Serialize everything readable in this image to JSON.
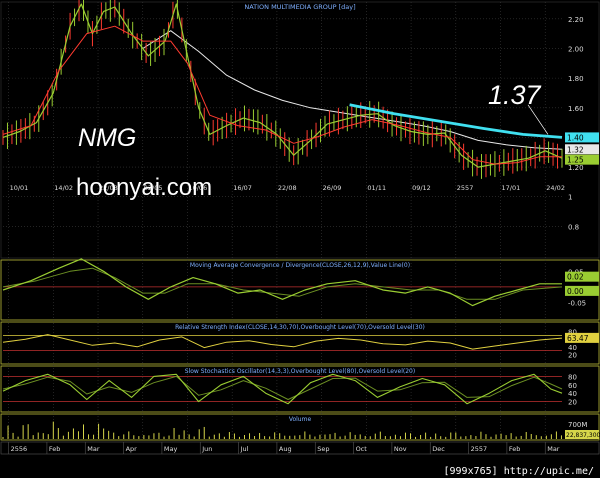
{
  "credit": "[999x765] http://upic.me/",
  "annotations": {
    "ticker": "NMG",
    "site": "hoonyai.com",
    "target": "1.37"
  },
  "colors": {
    "background": "#000000",
    "grid": "#3a3a3a",
    "axis_text": "#dddddd",
    "title_text": "#7fb0ff",
    "price_line": "#9acd32",
    "ma_short": "#ff3b30",
    "ma_long": "#e8e8e8",
    "trendline": "#40e0f0",
    "ref_line": "#e0d040",
    "oversold_line": "#c03030",
    "volume": "#d6d64a"
  },
  "chart_data": [
    {
      "type": "candlestick",
      "title": "NATION MULTIMEDIA GROUP [day]",
      "ylim": [
        0.6,
        2.3
      ],
      "yticks": [
        2.2,
        2.0,
        1.8,
        1.6,
        1.4,
        1.2,
        1.0,
        0.8
      ],
      "ytick_labels": [
        "2.20",
        "2.00",
        "1.80",
        "1.60",
        "1.40",
        "1.20",
        "1",
        "0.8"
      ],
      "last_value_labels": [
        {
          "value": 1.4,
          "label": "1.40",
          "color": "#40e0f0"
        },
        {
          "value": 1.32,
          "label": "1.32",
          "color": "#e8e8e8"
        },
        {
          "value": 1.25,
          "label": "1.25",
          "color": "#9acd32"
        }
      ],
      "date_labels": [
        "10/01",
        "14/02",
        "22/03",
        "02/05",
        "10/06",
        "16/07",
        "22/08",
        "26/09",
        "01/11",
        "09/12",
        "2557",
        "17/01",
        "24/02"
      ],
      "month_labels": [
        "2556",
        "Feb",
        "Mar",
        "Apr",
        "May",
        "Jun",
        "Jul",
        "Aug",
        "Sep",
        "Oct",
        "Nov",
        "Dec",
        "2557",
        "Feb",
        "Mar"
      ],
      "price_path": [
        [
          0,
          1.4
        ],
        [
          3,
          1.44
        ],
        [
          6,
          1.5
        ],
        [
          9,
          1.7
        ],
        [
          12,
          2.15
        ],
        [
          14,
          2.3
        ],
        [
          16,
          2.1
        ],
        [
          18,
          2.25
        ],
        [
          20,
          2.28
        ],
        [
          23,
          2.1
        ],
        [
          26,
          1.95
        ],
        [
          29,
          2.05
        ],
        [
          31,
          2.3
        ],
        [
          33,
          1.95
        ],
        [
          35,
          1.6
        ],
        [
          37,
          1.42
        ],
        [
          40,
          1.48
        ],
        [
          43,
          1.53
        ],
        [
          46,
          1.5
        ],
        [
          49,
          1.42
        ],
        [
          52,
          1.28
        ],
        [
          55,
          1.38
        ],
        [
          58,
          1.49
        ],
        [
          61,
          1.52
        ],
        [
          64,
          1.55
        ],
        [
          67,
          1.56
        ],
        [
          70,
          1.48
        ],
        [
          73,
          1.44
        ],
        [
          76,
          1.42
        ],
        [
          79,
          1.43
        ],
        [
          82,
          1.28
        ],
        [
          85,
          1.2
        ],
        [
          88,
          1.22
        ],
        [
          91,
          1.24
        ],
        [
          94,
          1.26
        ],
        [
          97,
          1.31
        ],
        [
          100,
          1.26
        ]
      ],
      "ma_short_path": [
        [
          0,
          1.42
        ],
        [
          5,
          1.48
        ],
        [
          10,
          1.85
        ],
        [
          15,
          2.1
        ],
        [
          20,
          2.15
        ],
        [
          25,
          2.05
        ],
        [
          30,
          2.05
        ],
        [
          33,
          1.9
        ],
        [
          37,
          1.55
        ],
        [
          42,
          1.48
        ],
        [
          47,
          1.45
        ],
        [
          52,
          1.36
        ],
        [
          56,
          1.4
        ],
        [
          61,
          1.47
        ],
        [
          66,
          1.52
        ],
        [
          71,
          1.48
        ],
        [
          76,
          1.43
        ],
        [
          80,
          1.4
        ],
        [
          84,
          1.25
        ],
        [
          88,
          1.22
        ],
        [
          92,
          1.23
        ],
        [
          96,
          1.27
        ],
        [
          100,
          1.27
        ]
      ],
      "ma_long_path": [
        [
          25,
          2.0
        ],
        [
          30,
          2.12
        ],
        [
          35,
          1.98
        ],
        [
          40,
          1.82
        ],
        [
          45,
          1.72
        ],
        [
          50,
          1.65
        ],
        [
          55,
          1.6
        ],
        [
          60,
          1.57
        ],
        [
          65,
          1.54
        ],
        [
          70,
          1.51
        ],
        [
          75,
          1.48
        ],
        [
          80,
          1.44
        ],
        [
          85,
          1.38
        ],
        [
          90,
          1.35
        ],
        [
          95,
          1.33
        ],
        [
          100,
          1.32
        ]
      ],
      "trendline": [
        [
          62,
          1.62
        ],
        [
          70,
          1.56
        ],
        [
          78,
          1.51
        ],
        [
          86,
          1.46
        ],
        [
          93,
          1.42
        ],
        [
          100,
          1.4
        ]
      ]
    },
    {
      "type": "line",
      "title": "Moving Average Convergence / Divergence(CLOSE,26,12,9),Value Line(0)",
      "ylim": [
        -0.1,
        0.08
      ],
      "yticks": [
        0.05,
        -0.05
      ],
      "ytick_labels": [
        "0.05",
        "-0.05"
      ],
      "last_value_labels": [
        {
          "value": 0.02,
          "label": "0.02",
          "color": "#9acd32"
        },
        {
          "value": 0.0,
          "label": "0.00",
          "color": "#9acd32"
        }
      ],
      "ref_levels": [
        0
      ],
      "macd_path": [
        [
          0,
          -0.01
        ],
        [
          5,
          0.02
        ],
        [
          10,
          0.06
        ],
        [
          14,
          0.09
        ],
        [
          18,
          0.05
        ],
        [
          22,
          0.0
        ],
        [
          26,
          -0.04
        ],
        [
          30,
          0.0
        ],
        [
          34,
          0.03
        ],
        [
          38,
          0.01
        ],
        [
          42,
          -0.02
        ],
        [
          46,
          -0.01
        ],
        [
          50,
          -0.04
        ],
        [
          54,
          -0.01
        ],
        [
          58,
          0.01
        ],
        [
          63,
          0.02
        ],
        [
          68,
          -0.01
        ],
        [
          72,
          -0.02
        ],
        [
          76,
          0.0
        ],
        [
          80,
          -0.02
        ],
        [
          84,
          -0.06
        ],
        [
          88,
          -0.03
        ],
        [
          92,
          -0.01
        ],
        [
          96,
          0.01
        ],
        [
          100,
          0.01
        ]
      ],
      "signal_path": [
        [
          0,
          0.0
        ],
        [
          6,
          0.02
        ],
        [
          12,
          0.05
        ],
        [
          16,
          0.06
        ],
        [
          20,
          0.03
        ],
        [
          25,
          -0.02
        ],
        [
          29,
          -0.02
        ],
        [
          33,
          0.01
        ],
        [
          38,
          0.01
        ],
        [
          43,
          -0.01
        ],
        [
          48,
          -0.02
        ],
        [
          53,
          -0.03
        ],
        [
          58,
          0.0
        ],
        [
          63,
          0.01
        ],
        [
          68,
          0.0
        ],
        [
          73,
          -0.01
        ],
        [
          78,
          -0.01
        ],
        [
          83,
          -0.04
        ],
        [
          88,
          -0.04
        ],
        [
          93,
          -0.01
        ],
        [
          100,
          0.0
        ]
      ]
    },
    {
      "type": "line",
      "title": "Relative Strength Index(CLOSE,14,30,70),Overbought Level(70),Oversold Level(30)",
      "ylim": [
        0,
        100
      ],
      "yticks": [
        80,
        60,
        40,
        20
      ],
      "ytick_labels": [
        "80",
        "60",
        "40",
        "20"
      ],
      "last_value_labels": [
        {
          "value": 63.47,
          "label": "63.47",
          "color": "#e0d040"
        }
      ],
      "ref_levels": [
        70,
        30
      ],
      "rsi_path": [
        [
          0,
          52
        ],
        [
          4,
          60
        ],
        [
          8,
          72
        ],
        [
          12,
          58
        ],
        [
          16,
          44
        ],
        [
          20,
          50
        ],
        [
          24,
          40
        ],
        [
          28,
          58
        ],
        [
          32,
          66
        ],
        [
          36,
          38
        ],
        [
          40,
          52
        ],
        [
          44,
          56
        ],
        [
          48,
          46
        ],
        [
          52,
          40
        ],
        [
          56,
          55
        ],
        [
          60,
          62
        ],
        [
          64,
          58
        ],
        [
          68,
          48
        ],
        [
          72,
          45
        ],
        [
          76,
          55
        ],
        [
          80,
          50
        ],
        [
          84,
          34
        ],
        [
          88,
          42
        ],
        [
          92,
          50
        ],
        [
          96,
          58
        ],
        [
          100,
          63
        ]
      ]
    },
    {
      "type": "line",
      "title": "Slow Stochastics Oscillator(14,3,3),Overbought Level(80),Oversold Level(20)",
      "ylim": [
        0,
        100
      ],
      "yticks": [
        80,
        60,
        40,
        20
      ],
      "ytick_labels": [
        "80",
        "60",
        "40",
        "20"
      ],
      "ref_levels": [
        80,
        20
      ],
      "stoch_k_path": [
        [
          0,
          45
        ],
        [
          4,
          70
        ],
        [
          8,
          85
        ],
        [
          12,
          60
        ],
        [
          15,
          25
        ],
        [
          19,
          70
        ],
        [
          23,
          30
        ],
        [
          27,
          80
        ],
        [
          31,
          85
        ],
        [
          35,
          20
        ],
        [
          39,
          60
        ],
        [
          43,
          80
        ],
        [
          47,
          40
        ],
        [
          51,
          15
        ],
        [
          55,
          65
        ],
        [
          59,
          85
        ],
        [
          63,
          70
        ],
        [
          67,
          30
        ],
        [
          71,
          55
        ],
        [
          75,
          75
        ],
        [
          79,
          60
        ],
        [
          83,
          15
        ],
        [
          87,
          40
        ],
        [
          91,
          70
        ],
        [
          95,
          85
        ],
        [
          98,
          50
        ],
        [
          100,
          40
        ]
      ],
      "stoch_d_path": [
        [
          0,
          50
        ],
        [
          4,
          62
        ],
        [
          8,
          78
        ],
        [
          12,
          68
        ],
        [
          15,
          38
        ],
        [
          19,
          55
        ],
        [
          23,
          42
        ],
        [
          27,
          65
        ],
        [
          31,
          80
        ],
        [
          35,
          35
        ],
        [
          39,
          48
        ],
        [
          43,
          70
        ],
        [
          47,
          52
        ],
        [
          51,
          25
        ],
        [
          55,
          50
        ],
        [
          59,
          75
        ],
        [
          63,
          76
        ],
        [
          67,
          45
        ],
        [
          71,
          48
        ],
        [
          75,
          65
        ],
        [
          79,
          66
        ],
        [
          83,
          30
        ],
        [
          87,
          32
        ],
        [
          91,
          58
        ],
        [
          95,
          78
        ],
        [
          98,
          62
        ],
        [
          100,
          50
        ]
      ]
    },
    {
      "type": "bar",
      "title": "Volume",
      "yticks": [
        700
      ],
      "ytick_labels": [
        "700M"
      ],
      "last_value_labels": [
        {
          "value": 22837300,
          "label": "22,837,300",
          "color": "#d6d64a"
        }
      ]
    }
  ]
}
